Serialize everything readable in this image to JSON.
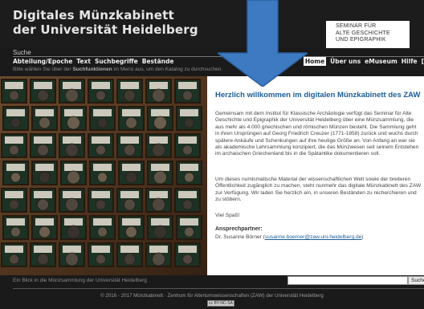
{
  "header": {
    "title_line1": "Digitales Münzkabinett",
    "title_line2": "der Universität Heidelberg",
    "seminar_line1": "SEMINAR FÜR",
    "seminar_line2": "ALTE GESCHICHTE",
    "seminar_line3": "UND EPIGRAPHIK"
  },
  "search": {
    "section_label": "Suche",
    "hint_before": "Bitte wählen Sie über der ",
    "hint_bold": "Suchfunktionen",
    "hint_after": " im Menü aus, um den Katalog zu durchsuchen.",
    "input_value": "",
    "button_label": "Suche"
  },
  "nav": {
    "left": [
      "Abteilung/Epoche",
      "Text",
      "Suchbegriffe",
      "Bestände"
    ],
    "right": [
      "Home",
      "Über uns",
      "eMuseum",
      "Hilfe",
      "["
    ],
    "active": "Home"
  },
  "main": {
    "welcome_title": "Herzlich willkommen im digitalen Münzkabinett des ZAW",
    "paragraph1": "Gemeinsam mit dem Institut für Klassische Archäologie verfügt das Seminar für Alte Geschichte und Epigraphik der Universität Heidelberg über eine Münzsammlung, die aus mehr als 4.000 griechischen und römischen Münzen besteht. Die Sammlung geht in ihren Ursprüngen auf Georg Friedrich Creuzer (1771-1858) zurück und wuchs durch spätere Ankäufe und Schenkungen auf ihre heutige Größe an. Von Anfang an war sie als akademische Lehrsammlung konzipiert, die das Münzwesen seit seinem Entstehen im archaischen Griechenland bis in die Spätantike dokumentieren soll.",
    "paragraph2": "Um dieses numismatische Material der wissenschaftlichen Welt sowie der breiteren Öffentlichkeit zugänglich zu machen, steht nunmehr das digitale Münzkabinett des ZAW zur Verfügung. Wir laden Sie herzlich ein, in unseren Beständen zu recherchieren und zu stöbern.",
    "paragraph3": "Viel Spaß!",
    "contact_heading": "Ansprechpartner:",
    "contact_name": "Dr. Susanne Börner (",
    "contact_email": "susanne.boerner@zaw.uni-heidelberg.de",
    "contact_close": ")"
  },
  "image_caption": "Ein Blick in die Münzsammlung der Universität Heidelberg",
  "footer": {
    "copyright": "© 2016 - 2017 Münzkabinett · Zentrum für Altertumswissenschaften (ZAW) der Universität Heidelberg",
    "license_badge": "cc BY-NC-SA"
  },
  "colors": {
    "background": "#1a1a1a",
    "link_blue": "#1a5e9a",
    "arrow_blue": "#3d7ac2",
    "tray_wood": "#6b4a30"
  }
}
